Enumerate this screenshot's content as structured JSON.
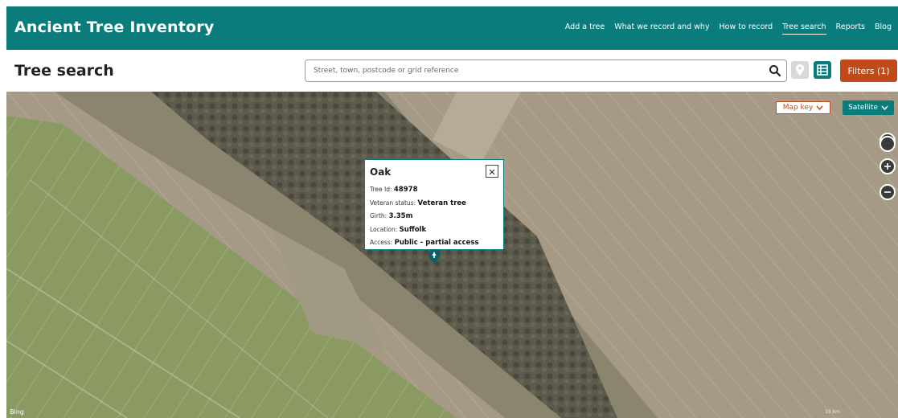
{
  "header": {
    "title": "Ancient Tree Inventory",
    "nav": [
      {
        "label": "Add a tree"
      },
      {
        "label": "What we record and why"
      },
      {
        "label": "How to record"
      },
      {
        "label": "Tree search",
        "active": true
      },
      {
        "label": "Reports"
      },
      {
        "label": "Blog"
      }
    ]
  },
  "toolbar": {
    "page_title": "Tree search",
    "search_placeholder": "Street, town, postcode or grid reference",
    "filters_label": "Filters (1)"
  },
  "map": {
    "map_key_label": "Map key",
    "satellite_label": "Satellite",
    "attribution": "Bing",
    "scale_text": "10 km"
  },
  "popup": {
    "title": "Oak",
    "rows": [
      {
        "label": "Tree Id:",
        "value": "48978"
      },
      {
        "label": "Veteran status:",
        "value": "Veteran tree"
      },
      {
        "label": "Girth:",
        "value": "3.35m"
      },
      {
        "label": "Location:",
        "value": "Suffolk"
      },
      {
        "label": "Access:",
        "value": "Public - partial access"
      }
    ]
  },
  "colors": {
    "brand_teal": "#0b7c7c",
    "accent_orange": "#c04a1a"
  },
  "icons": {
    "search": "search-icon",
    "pin": "location-pin-icon",
    "list": "list-view-icon",
    "close": "close-icon",
    "chevron": "chevron-down-icon",
    "locate": "locate-icon",
    "zoom_in": "zoom-in-icon",
    "zoom_out": "zoom-out-icon",
    "tree_marker": "tree-marker-icon"
  }
}
